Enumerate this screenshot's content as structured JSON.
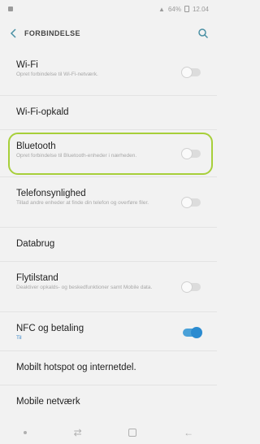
{
  "statusbar": {
    "battery": "64%",
    "time": "12.04"
  },
  "header": {
    "title": "FORBINDELSE"
  },
  "items": [
    {
      "title": "Wi-Fi",
      "sub": "Opret forbindelse til Wi-Fi-netværk.",
      "toggle": "off"
    },
    {
      "title": "Wi-Fi-opkald"
    },
    {
      "title": "Bluetooth",
      "sub": "Opret forbindelse til Bluetooth-enheder i nærheden.",
      "toggle": "off"
    },
    {
      "title": "Telefonsynlighed",
      "sub": "Tillad andre enheder at finde din telefon og overføre filer.",
      "toggle": "off"
    },
    {
      "title": "Databrug"
    },
    {
      "title": "Flytilstand",
      "sub": "Deaktiver opkalds- og beskedfunktioner samt Mobile data.",
      "toggle": "off"
    },
    {
      "title": "NFC og betaling",
      "sub": "Til",
      "toggle": "on"
    },
    {
      "title": "Mobilt hotspot og internetdel."
    },
    {
      "title": "Mobile netværk"
    }
  ],
  "colors": {
    "accent": "#4aa1d8",
    "highlight": "#a7cf3a"
  }
}
